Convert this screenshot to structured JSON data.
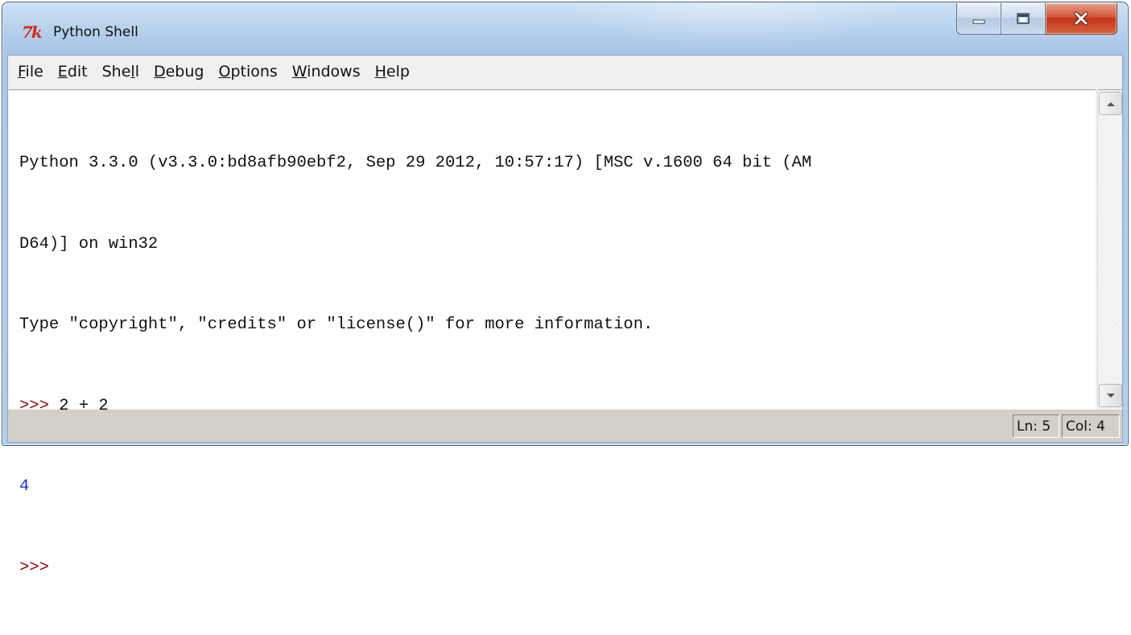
{
  "window": {
    "title": "Python Shell",
    "app_icon": "7k",
    "icon_name": "tk-icon",
    "buttons": [
      "minimize-icon",
      "maximize-icon",
      "close-icon"
    ]
  },
  "menubar": {
    "items": [
      {
        "label": "File",
        "accel": "F",
        "rest": "ile"
      },
      {
        "label": "Edit",
        "accel": "E",
        "rest": "dit"
      },
      {
        "label": "Shell",
        "pre": "She",
        "accel": "l",
        "rest": "l"
      },
      {
        "label": "Debug",
        "accel": "D",
        "rest": "ebug"
      },
      {
        "label": "Options",
        "accel": "O",
        "rest": "ptions"
      },
      {
        "label": "Windows",
        "accel": "W",
        "rest": "indows"
      },
      {
        "label": "Help",
        "accel": "H",
        "rest": "elp"
      }
    ]
  },
  "shell": {
    "lines": [
      {
        "text": "Python 3.3.0 (v3.3.0:bd8afb90ebf2, Sep 29 2012, 10:57:17) [MSC v.1600 64 bit (AM"
      },
      {
        "text": "D64)] on win32"
      },
      {
        "text": "Type \"copyright\", \"credits\" or \"license()\" for more information."
      },
      {
        "prompt": ">>> ",
        "text": "2 + 2"
      },
      {
        "output": "4"
      },
      {
        "prompt": ">>> ",
        "text": ""
      }
    ]
  },
  "statusbar": {
    "ln": "Ln: 5",
    "col": "Col: 4"
  },
  "colors": {
    "prompt": "#8b0000",
    "output": "#1a33c8",
    "text": "#111111"
  }
}
